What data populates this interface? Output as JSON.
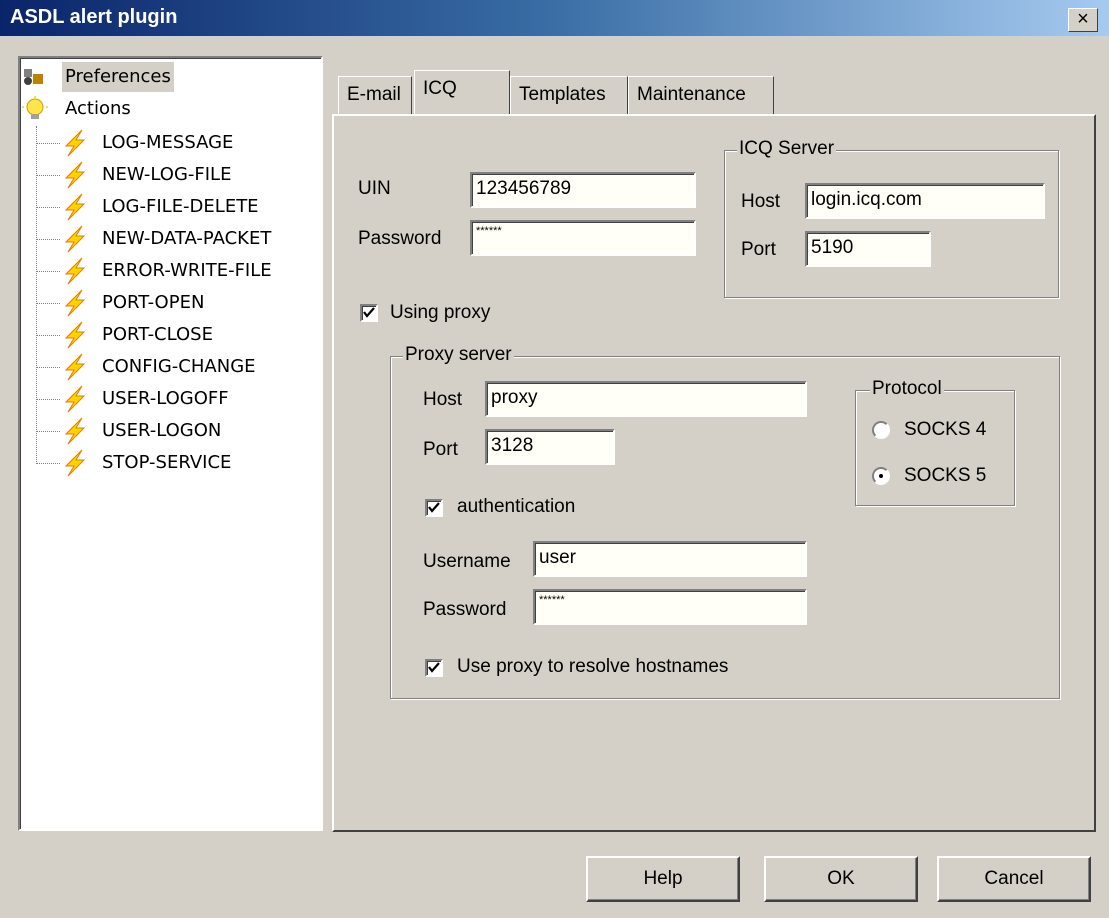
{
  "window": {
    "title": "ASDL alert plugin",
    "close_glyph": "×"
  },
  "tree": {
    "preferences": "Preferences",
    "actions": "Actions",
    "action_items": [
      "LOG-MESSAGE",
      "NEW-LOG-FILE",
      "LOG-FILE-DELETE",
      "NEW-DATA-PACKET",
      "ERROR-WRITE-FILE",
      "PORT-OPEN",
      "PORT-CLOSE",
      "CONFIG-CHANGE",
      "USER-LOGOFF",
      "USER-LOGON",
      "STOP-SERVICE"
    ]
  },
  "tabs": [
    "E-mail",
    "ICQ",
    "Templates",
    "Maintenance"
  ],
  "active_tab": "ICQ",
  "icq": {
    "uin_label": "UIN",
    "uin_value": "123456789",
    "password_label": "Password",
    "password_value": "******",
    "server": {
      "legend": "ICQ Server",
      "host_label": "Host",
      "host_value": "login.icq.com",
      "port_label": "Port",
      "port_value": "5190"
    }
  },
  "using_proxy": {
    "label": "Using proxy",
    "checked": true
  },
  "proxy": {
    "legend": "Proxy server",
    "host_label": "Host",
    "host_value": "proxy",
    "port_label": "Port",
    "port_value": "3128",
    "auth_label": "authentication",
    "auth_checked": true,
    "username_label": "Username",
    "username_value": "user",
    "password_label": "Password",
    "password_value": "******",
    "resolve_label": "Use proxy to resolve hostnames",
    "resolve_checked": true
  },
  "protocol": {
    "legend": "Protocol",
    "options": [
      "SOCKS 4",
      "SOCKS 5"
    ],
    "selected": "SOCKS 5"
  },
  "buttons": {
    "help": "Help",
    "ok": "OK",
    "cancel": "Cancel"
  },
  "colors": {
    "titlebar_start": "#0a246a",
    "face": "#d4d0c8",
    "field_bg": "#fffff8"
  },
  "icons": {
    "preferences": "preferences-icon",
    "actions": "lightbulb-icon",
    "action": "lightning-bolt-icon"
  }
}
